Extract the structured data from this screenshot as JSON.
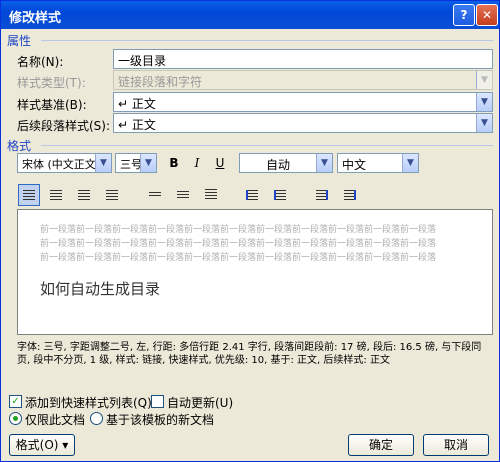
{
  "title": "修改样式",
  "help_glyph": "?",
  "close_glyph": "✕",
  "sections": {
    "properties": "属性",
    "format": "格式"
  },
  "fields": {
    "name_label": "名称(N):",
    "name_value": "一级目录",
    "style_type_label": "样式类型(T):",
    "style_type_value": "链接段落和字符",
    "based_on_label": "样式基准(B):",
    "based_on_value": "正文",
    "next_style_label": "后续段落样式(S):",
    "next_style_value": "正文"
  },
  "format_bar": {
    "font": "宋体 (中文正文",
    "size": "三号",
    "bold": "B",
    "italic": "I",
    "underline": "U",
    "color": "自动",
    "language": "中文"
  },
  "preview": {
    "gray_line": "前一段落前一段落前一段落前一段落前一段落前一段落前一段落前一段落前一段落前一段落前一段落",
    "main_text": "如何自动生成目录"
  },
  "description": "字体: 三号, 字距调整二号, 左, 行距: 多倍行距 2.41 字行, 段落间距段前: 17 磅, 段后: 16.5 磅, 与下段同页, 段中不分页, 1 级, 样式: 链接, 快速样式, 优先级: 10, 基于: 正文, 后续样式: 正文",
  "options": {
    "add_quick_style": "添加到快速样式列表(Q)",
    "auto_update": "自动更新(U)",
    "only_this_doc": "仅限此文档",
    "new_docs_template": "基于该模板的新文档"
  },
  "buttons": {
    "format": "格式(O) ▾",
    "ok": "确定",
    "cancel": "取消"
  },
  "state": {
    "add_quick_style_checked": true,
    "auto_update_checked": false,
    "scope_selected": "only_this_doc"
  }
}
